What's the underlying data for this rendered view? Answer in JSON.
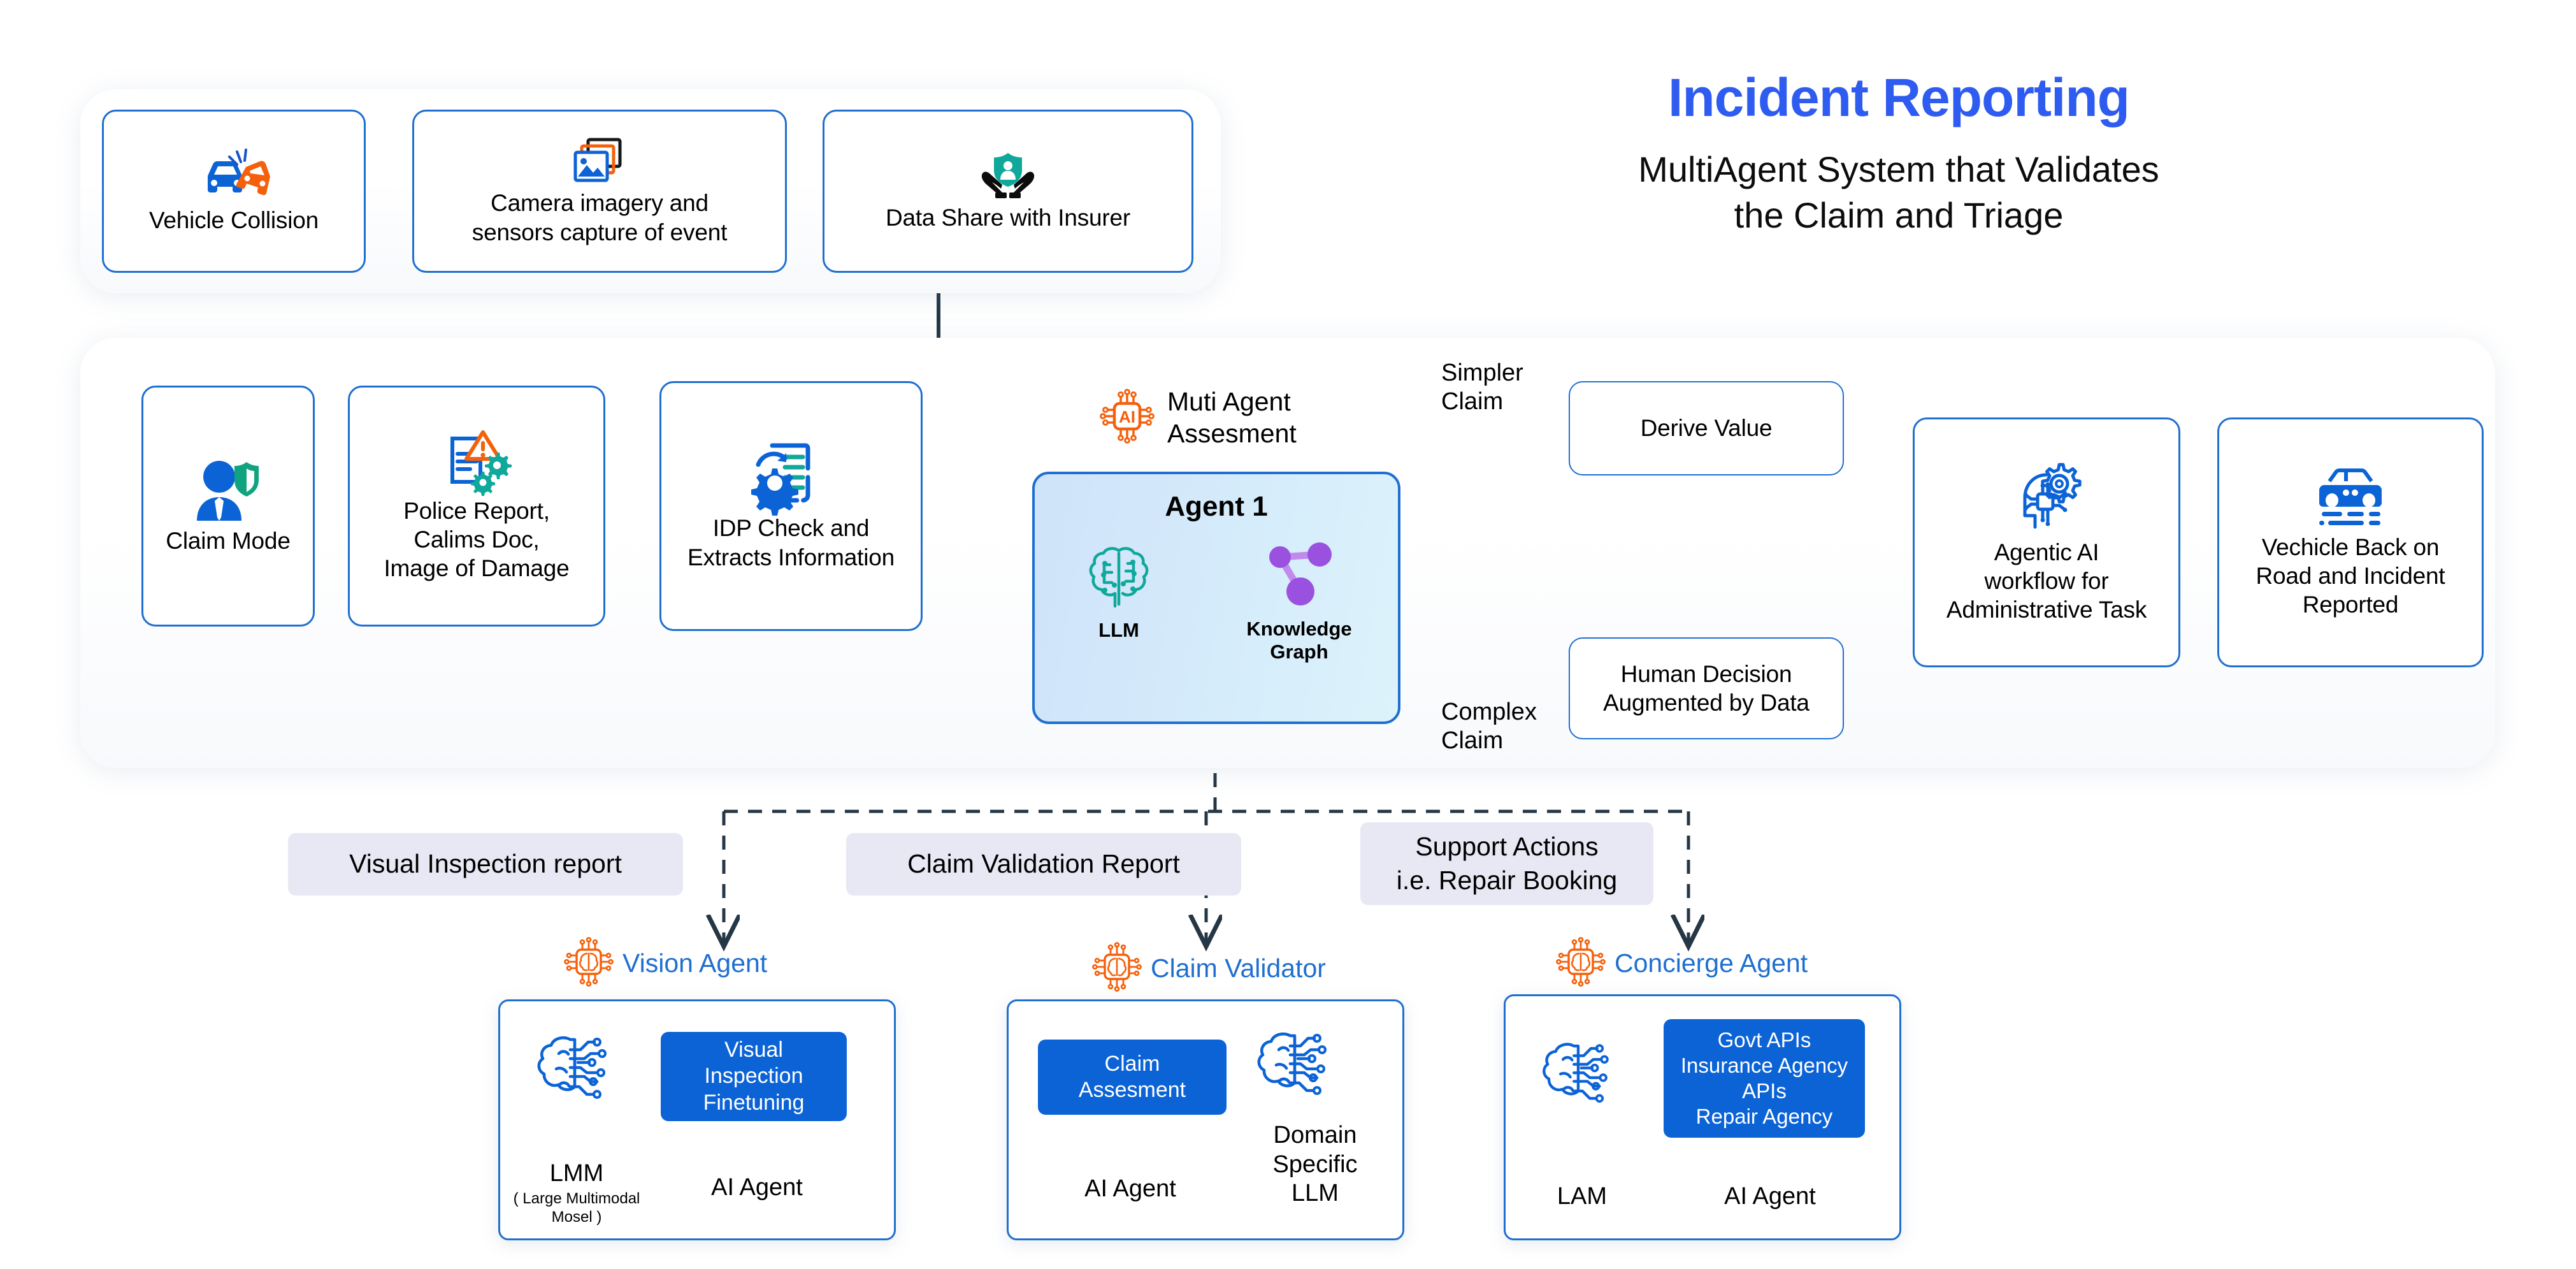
{
  "header": {
    "title": "Incident Reporting",
    "subtitle_line1": "MultiAgent System that Validates",
    "subtitle_line2": "the Claim and Triage",
    "title_color": "#2f5cf0"
  },
  "top_flow": {
    "steps": [
      {
        "label": "Vehicle Collision",
        "icon": "car-collision-icon"
      },
      {
        "label_line1": "Camera imagery and",
        "label_line2": "sensors capture of event",
        "icon": "photo-stack-icon"
      },
      {
        "label": "Data Share with Insurer",
        "icon": "hands-shield-person-icon"
      }
    ],
    "connector": "arrow-right"
  },
  "main_flow": {
    "steps": [
      {
        "label": "Claim Mode",
        "icon": "person-shield-icon"
      },
      {
        "label_line1": "Police Report,",
        "label_line2": "Calims Doc,",
        "label_line3": "Image of Damage",
        "icon": "document-alert-gears-icon"
      },
      {
        "label_line1": "IDP Check and",
        "label_line2": "Extracts Information",
        "icon": "document-gear-refresh-icon"
      }
    ],
    "assessment_badge": {
      "icon": "ai-chip-icon",
      "label_line1": "Muti Agent",
      "label_line2": "Assesment",
      "icon_color": "#f4600b"
    },
    "agent1": {
      "title": "Agent 1",
      "left": {
        "icon": "brain-circuit-icon",
        "caption": "LLM",
        "color": "#10a37f"
      },
      "right": {
        "icon": "knowledge-graph-icon",
        "caption_line1": "Knowledge",
        "caption_line2": "Graph",
        "color": "#9b51e0"
      },
      "bg_from": "#cfe3f9",
      "bg_to": "#dcf3fb",
      "border": "#1f6fd0"
    },
    "branches": [
      {
        "edge_label_line1": "Simpler",
        "edge_label_line2": "Claim",
        "target": "Derive Value"
      },
      {
        "edge_label_line1": "Complex",
        "edge_label_line2": "Claim",
        "target_line1": "Human Decision",
        "target_line2": "Augmented by Data"
      }
    ],
    "outcomes": [
      {
        "label_line1": "Agentic AI",
        "label_line2": "workflow for",
        "label_line3": "Administrative Task",
        "icon": "ai-head-gear-icon"
      },
      {
        "label_line1": "Vechicle Back on",
        "label_line2": "Road and Incident",
        "label_line3": "Reported",
        "icon": "car-front-icon"
      }
    ]
  },
  "outputs": {
    "pills": [
      {
        "label": "Visual Inspection report"
      },
      {
        "label": "Claim Validation Report"
      },
      {
        "label_line1": "Support Actions",
        "label_line2": "i.e. Repair Booking"
      }
    ],
    "pill_bg": "#e8e8f4"
  },
  "agents": [
    {
      "name": "Vision Agent",
      "icon": "ai-brain-chip-icon",
      "left": {
        "icon": "brain-circuit-outline-icon",
        "caption": "LMM",
        "sub": "( Large Multimodal Mosel )"
      },
      "chip": {
        "line1": "Visual",
        "line2": "Inspection",
        "line3": "Finetuning"
      },
      "chip_side": "right",
      "right_caption": "AI Agent"
    },
    {
      "name": "Claim Validator",
      "icon": "ai-brain-chip-icon",
      "chip": {
        "line1": "Claim",
        "line2": "Assesment"
      },
      "chip_side": "left",
      "left_caption": "AI Agent",
      "right": {
        "icon": "brain-circuit-outline-icon",
        "caption_line1": "Domain",
        "caption_line2": "Specific",
        "caption_line3": "LLM"
      }
    },
    {
      "name": "Concierge Agent",
      "icon": "ai-brain-chip-icon",
      "left": {
        "icon": "brain-circuit-outline-icon",
        "caption": "LAM"
      },
      "chip": {
        "line1": "Govt APIs",
        "line2": "Insurance Agency",
        "line3": "APIs",
        "line4": "Repair Agency"
      },
      "chip_side": "right",
      "right_caption": "AI Agent"
    }
  ],
  "colors": {
    "blue": "#1f6fd0",
    "deep_blue": "#0b63d6",
    "orange": "#f4600b",
    "teal": "#10a37f",
    "purple": "#9b51e0",
    "line": "#253645"
  }
}
